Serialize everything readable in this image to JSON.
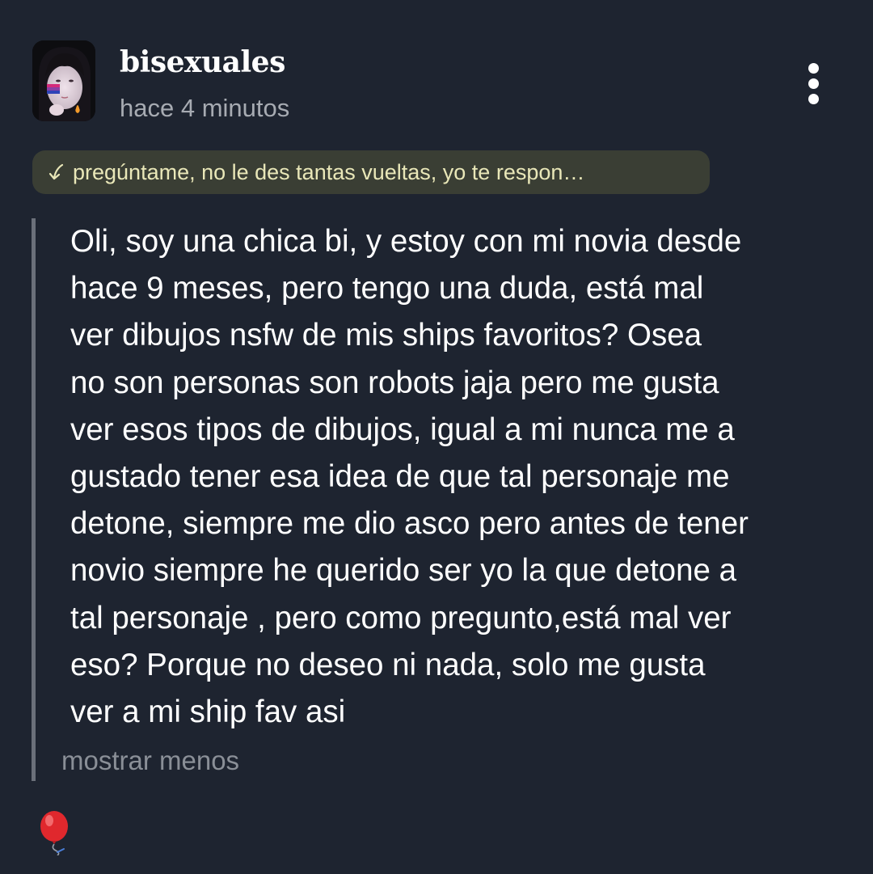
{
  "post": {
    "author": "bisexuales",
    "timestamp": "hace 4 minutos",
    "question": "pregúntame, no le des tantas vueltas, yo te respon…",
    "body_lines": [
      "Oli, soy una chica bi, y estoy con mi novia desde",
      "hace 9 meses, pero tengo una duda, está mal",
      "ver dibujos nsfw de mis ships favoritos? Osea",
      "no son personas son robots jaja pero me gusta",
      "ver esos tipos de dibujos, igual a mi nunca me a",
      "gustado tener esa idea de que tal personaje me",
      "detone, siempre me dio asco pero antes de tener",
      "novio siempre he querido ser yo la que detone a",
      "tal personaje , pero como pregunto,está mal ver",
      "eso? Porque no deseo ni nada, solo me gusta",
      "ver a mi ship fav asi"
    ],
    "show_less": "mostrar menos"
  },
  "icons": {
    "more": "more-vertical-icon",
    "reply": "reply-arrow-icon",
    "reaction": "balloon-icon"
  },
  "colors": {
    "background": "#1e2430",
    "question_pill_bg": "#3a3e34",
    "question_text": "#e9e7b8",
    "muted_text": "#a7abb2",
    "quote_bar": "#6b707a",
    "reaction": "#e0282d"
  }
}
